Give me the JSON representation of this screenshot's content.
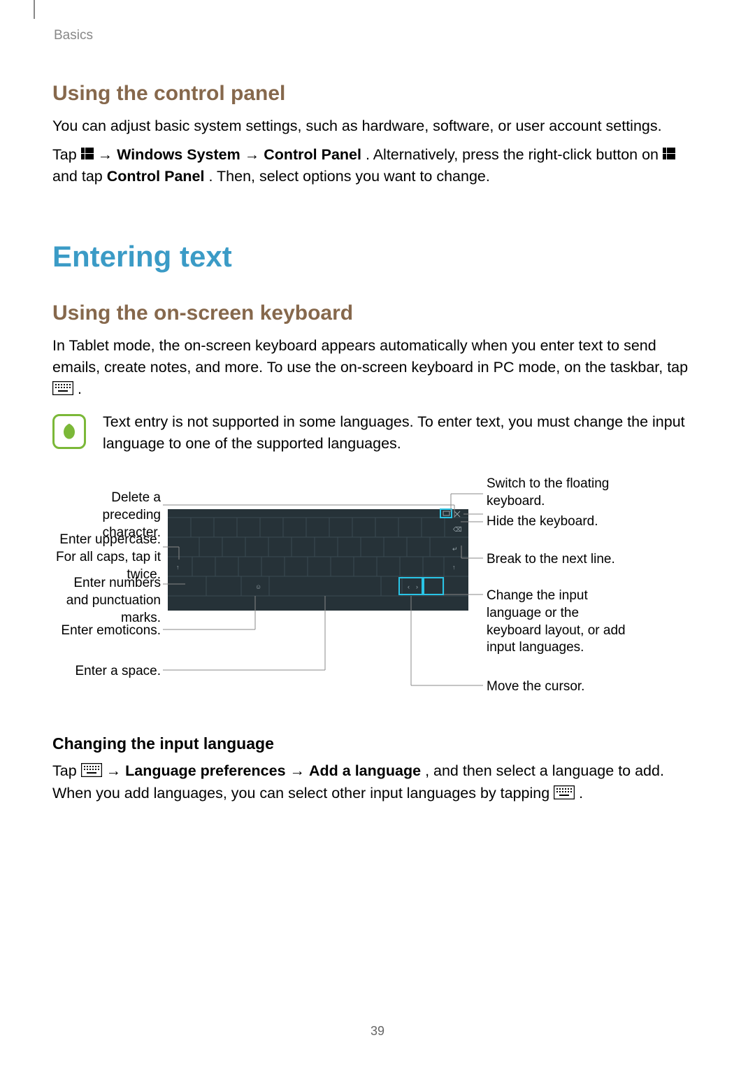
{
  "header": {
    "section": "Basics"
  },
  "page_number": "39",
  "section1": {
    "heading": "Using the control panel",
    "p1": "You can adjust basic system settings, such as hardware, software, or user account settings.",
    "p2a": "Tap ",
    "p2_arrow": " → ",
    "p2b": "Windows System",
    "p2c": "Control Panel",
    "p2d": ". Alternatively, press the right-click button on ",
    "p2e": " and tap ",
    "p2f": "Control Panel",
    "p2g": ". Then, select options you want to change."
  },
  "title": "Entering text",
  "section2": {
    "heading": "Using the on-screen keyboard",
    "p1": "In Tablet mode, the on-screen keyboard appears automatically when you enter text to send emails, create notes, and more. To use the on-screen keyboard in PC mode, on the taskbar, tap ",
    "p1_end": ".",
    "note": "Text entry is not supported in some languages. To enter text, you must change the input language to one of the supported languages."
  },
  "callouts": {
    "l1": "Delete a preceding character.",
    "l2": "Enter uppercase. For all caps, tap it twice.",
    "l3": "Enter numbers and punctuation marks.",
    "l4": "Enter emoticons.",
    "l5": "Enter a space.",
    "r1": "Switch to the floating keyboard.",
    "r2": "Hide the keyboard.",
    "r3": "Break to the next line.",
    "r4": "Change the input language or the keyboard layout, or add input languages.",
    "r5": "Move the cursor."
  },
  "section3": {
    "heading": "Changing the input language",
    "p1a": "Tap ",
    "p1_arrow": " → ",
    "p1b": "Language preferences",
    "p1c": "Add a language",
    "p1d": ", and then select a language to add. When you add languages, you can select other input languages by tapping ",
    "p1e": "."
  }
}
